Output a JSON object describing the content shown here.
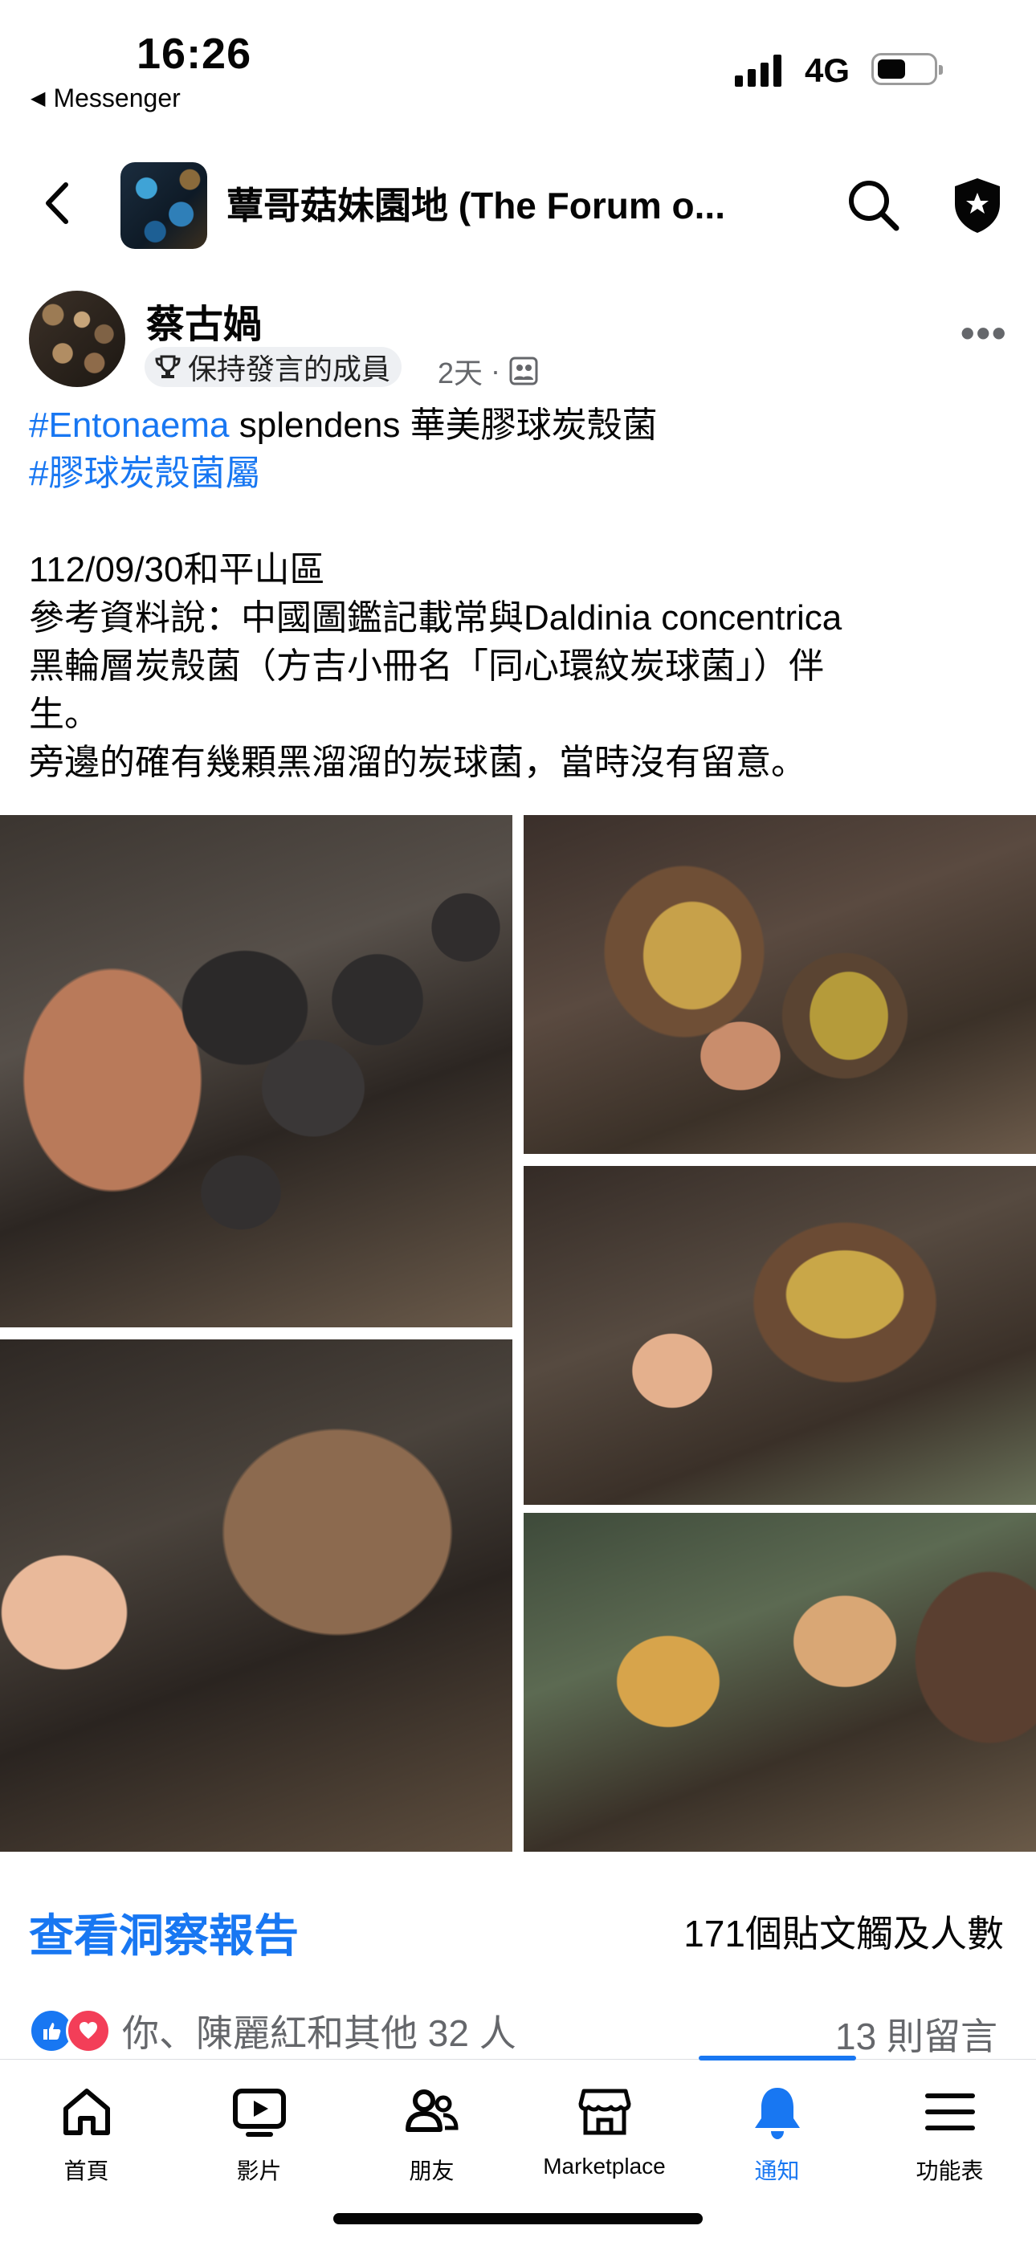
{
  "status_bar": {
    "time": "16:26",
    "back_app": "Messenger",
    "network": "4G"
  },
  "header": {
    "group_title": "蕈哥菇妹園地 (The Forum o..."
  },
  "post": {
    "author": "蔡古媧",
    "badge": "保持發言的成員",
    "time": "2天",
    "hashtag1": "#Entonaema",
    "line1_rest": " splendens 華美膠球炭殼菌",
    "hashtag2": "#膠球炭殼菌屬",
    "line3": "112/09/30和平山區",
    "line4": "參考資料說：中國圖鑑記載常與Daldinia concentrica",
    "line5": "黑輪層炭殼菌（方吉小冊名「同心環紋炭球菌」）伴",
    "line6": "生。",
    "line7": "旁邊的確有幾顆黑溜溜的炭球菌，當時沒有留意。"
  },
  "insights": {
    "link": "查看洞察報告",
    "reach": "171個貼文觸及人數"
  },
  "engagement": {
    "reactions": "你、陳麗紅和其他 32 人",
    "comments": "13 則留言"
  },
  "tabs": [
    {
      "label": "首頁",
      "icon": "home-icon"
    },
    {
      "label": "影片",
      "icon": "video-icon"
    },
    {
      "label": "朋友",
      "icon": "friends-icon"
    },
    {
      "label": "Marketplace",
      "icon": "marketplace-icon"
    },
    {
      "label": "通知",
      "icon": "bell-icon",
      "active": true
    },
    {
      "label": "功能表",
      "icon": "menu-icon"
    }
  ],
  "colors": {
    "accent": "#1877f2",
    "like": "#1877f2",
    "love": "#f33e58",
    "secondary_text": "#65676b"
  }
}
